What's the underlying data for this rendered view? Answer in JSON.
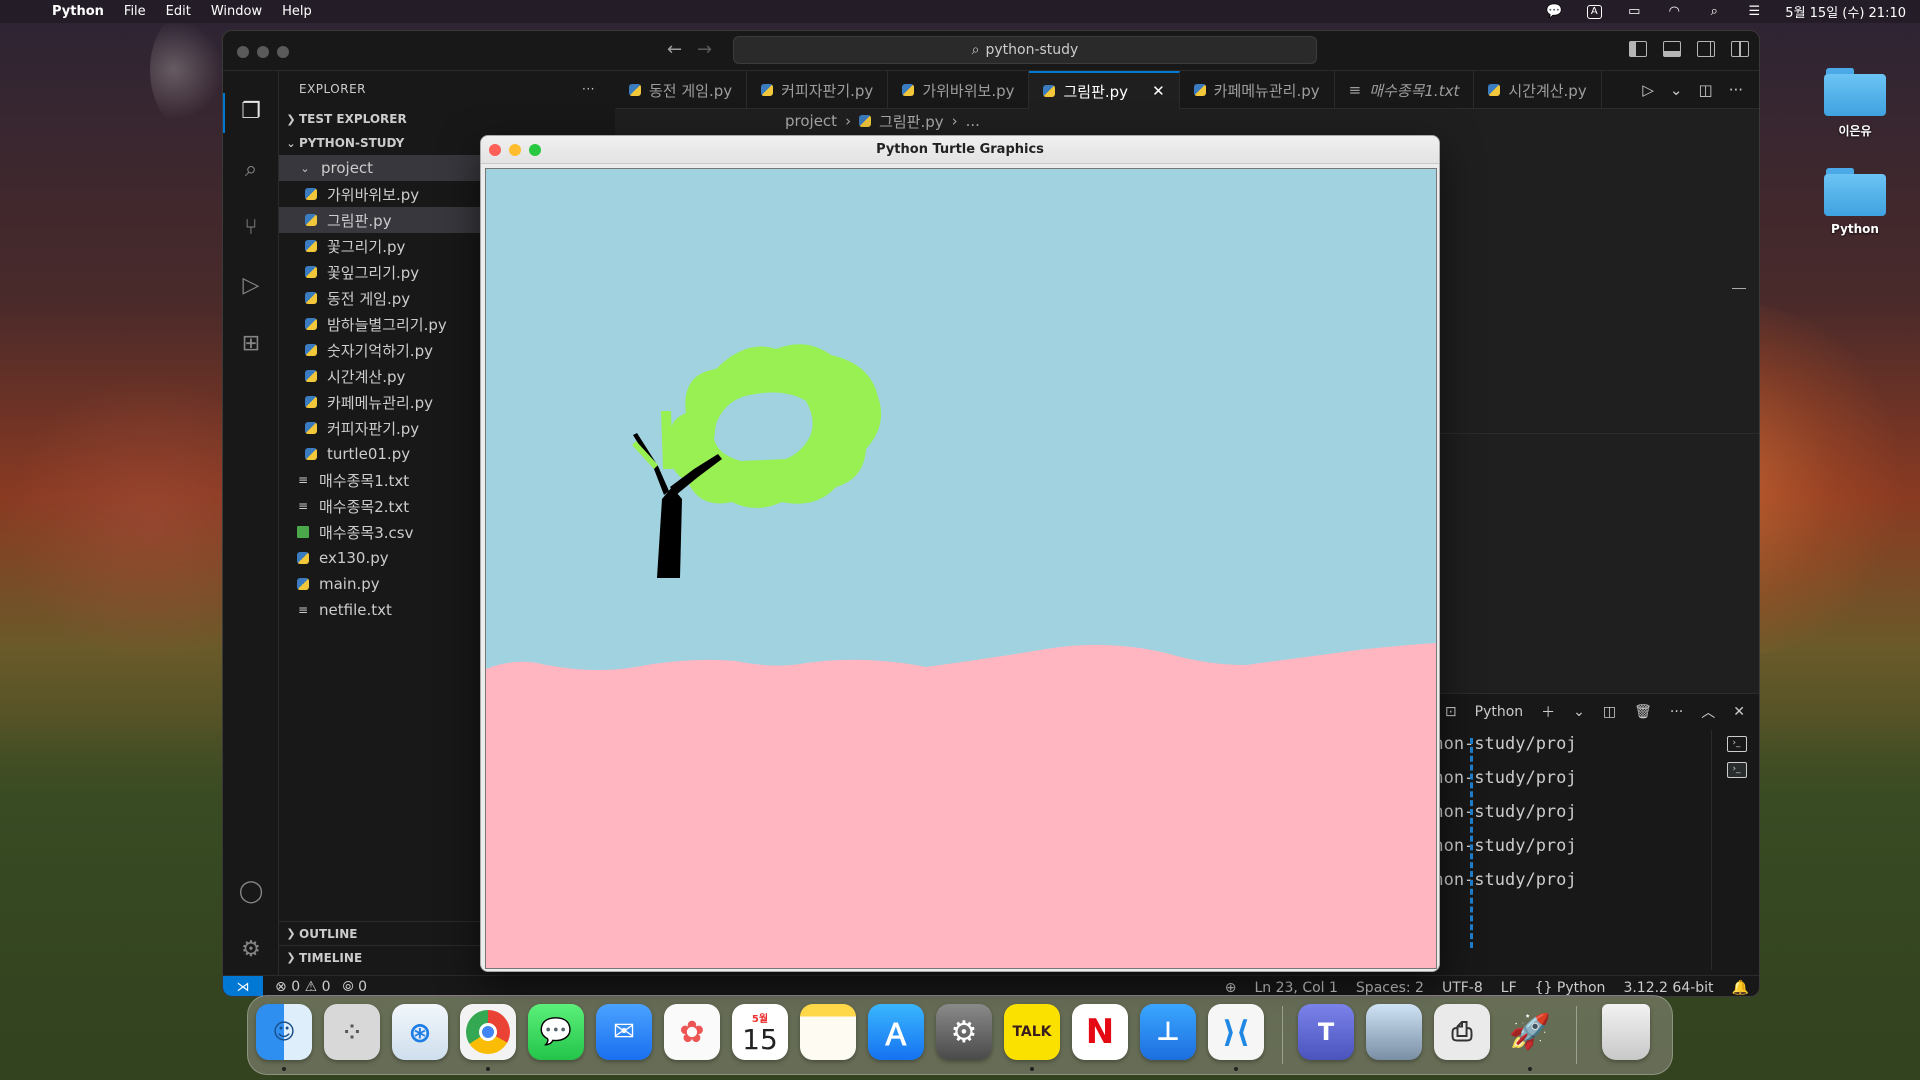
{
  "menubar": {
    "app": "Python",
    "items": [
      "File",
      "Edit",
      "Window",
      "Help"
    ],
    "input_indicator": "A",
    "clock": "5월 15일 (수) 21:10"
  },
  "desktop": {
    "icons": [
      {
        "label": "이은유"
      },
      {
        "label": "Python"
      }
    ]
  },
  "vscode": {
    "command_center": "python-study",
    "explorer": {
      "title": "EXPLORER",
      "more": "···",
      "sections": {
        "test_explorer": "TEST EXPLORER",
        "workspace": "PYTHON-STUDY",
        "outline": "OUTLINE",
        "timeline": "TIMELINE"
      },
      "folder": "project",
      "project_files": [
        {
          "name": "가위바위보.py",
          "type": "py"
        },
        {
          "name": "그림판.py",
          "type": "py"
        },
        {
          "name": "꽃그리기.py",
          "type": "py"
        },
        {
          "name": "꽃잎그리기.py",
          "type": "py"
        },
        {
          "name": "동전 게임.py",
          "type": "py"
        },
        {
          "name": "밤하늘별그리기.py",
          "type": "py"
        },
        {
          "name": "숫자기억하기.py",
          "type": "py"
        },
        {
          "name": "시간계산.py",
          "type": "py"
        },
        {
          "name": "카페메뉴관리.py",
          "type": "py"
        },
        {
          "name": "커피자판기.py",
          "type": "py"
        },
        {
          "name": "turtle01.py",
          "type": "py"
        }
      ],
      "root_files": [
        {
          "name": "매수종목1.txt",
          "type": "txt"
        },
        {
          "name": "매수종목2.txt",
          "type": "txt"
        },
        {
          "name": "매수종목3.csv",
          "type": "csv"
        },
        {
          "name": "ex130.py",
          "type": "py"
        },
        {
          "name": "main.py",
          "type": "py"
        },
        {
          "name": "netfile.txt",
          "type": "txt"
        }
      ]
    },
    "tabs": [
      {
        "label": "동전 게임.py",
        "active": false
      },
      {
        "label": "커피자판기.py",
        "active": false
      },
      {
        "label": "가위바위보.py",
        "active": false
      },
      {
        "label": "그림판.py",
        "active": true
      },
      {
        "label": "카페메뉴관리.py",
        "active": false
      },
      {
        "label": "매수종목1.txt",
        "active": false
      },
      {
        "label": "시간계산.py",
        "active": false
      }
    ],
    "breadcrumb": {
      "folder": "project",
      "file": "그림판.py",
      "more": "..."
    },
    "panel": {
      "terminal_name": "Python",
      "lines": [
        "Python/python-study/proj",
        "Python/python-study/proj",
        "Python/python-study/proj",
        "Python/python-study/proj",
        "Python/python-study/proj"
      ]
    },
    "status": {
      "errors": "0",
      "warnings": "0",
      "ports": "0",
      "position": "Ln 23, Col 1",
      "spaces": "Spaces: 2",
      "encoding": "UTF-8",
      "eol": "LF",
      "language": "Python",
      "interpreter": "3.12.2 64-bit"
    }
  },
  "turtle_window": {
    "title": "Python Turtle Graphics",
    "colors": {
      "sky": "#a0d2e0",
      "ground": "#ffb6c1",
      "trunk": "#000000",
      "leaves": "#99f053"
    }
  },
  "dock": {
    "apps": [
      "Finder",
      "Launchpad",
      "Safari",
      "Chrome",
      "Messages",
      "Mail",
      "Photos",
      "Calendar",
      "Notes",
      "App Store",
      "System Settings",
      "KakaoTalk",
      "Netflix",
      "Keynote",
      "VS Code",
      "Teams",
      "Preview",
      "Printer",
      "Python Launcher",
      "Trash"
    ],
    "calendar_month": "5월",
    "calendar_day": "15",
    "kakao_label": "TALK"
  }
}
